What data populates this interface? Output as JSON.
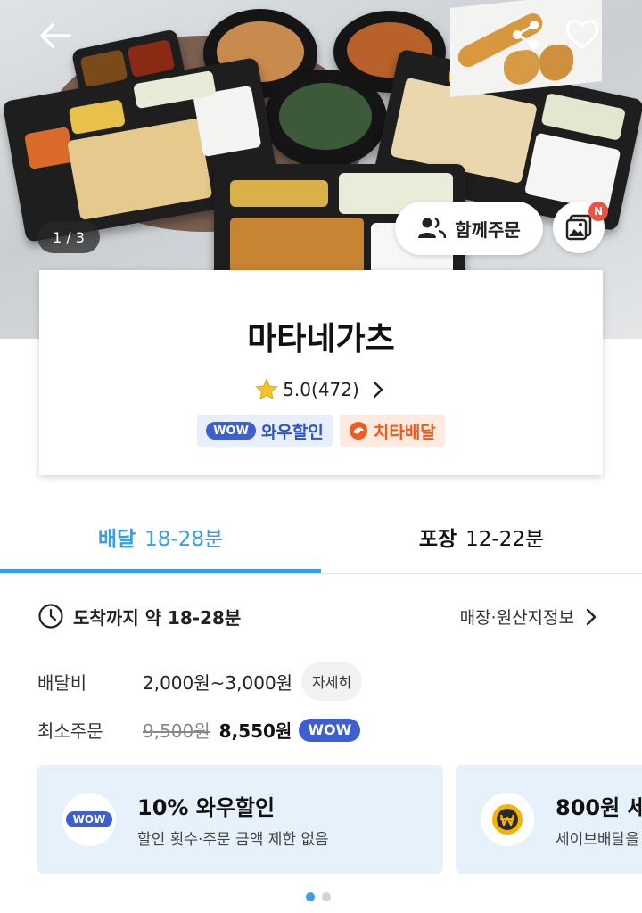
{
  "hero": {
    "image_counter": "1 / 3",
    "group_order_label": "함께주문",
    "photo_badge": "N",
    "icons": [
      "back-arrow-icon",
      "share-icon",
      "heart-icon",
      "people-icon",
      "photo-icon"
    ]
  },
  "store": {
    "name": "마타네가츠",
    "rating": "5.0(472)",
    "tags": [
      {
        "pill": "WOW",
        "label": "와우할인"
      },
      {
        "label": "치타배달"
      }
    ]
  },
  "tabs": [
    {
      "label": "배달",
      "time": "18-28분",
      "active": true
    },
    {
      "label": "포장",
      "time": "12-22분",
      "active": false
    }
  ],
  "info": {
    "arrival": "도착까지 약 18-28분",
    "store_info_link": "매장·원산지정보",
    "delivery_fee_label": "배달비",
    "delivery_fee_value": "2,000원~3,000원",
    "detail_button": "자세히",
    "min_order_label": "최소주문",
    "min_order_original": "9,500원",
    "min_order_discounted": "8,550원",
    "min_order_pill": "WOW"
  },
  "promos": [
    {
      "icon_text": "WOW",
      "title": "10% 와우할인",
      "subtitle": "할인 횟수·주문 금액 제한 없음"
    },
    {
      "title": "800원 세",
      "subtitle": "세이브배달을"
    }
  ],
  "pagination": {
    "total": 2,
    "current": 1
  },
  "colors": {
    "accent": "#3a9ee6",
    "wow": "#3d5fd0",
    "cheetah": "#f05a1e",
    "promo_bg": "#e7f1fc"
  }
}
